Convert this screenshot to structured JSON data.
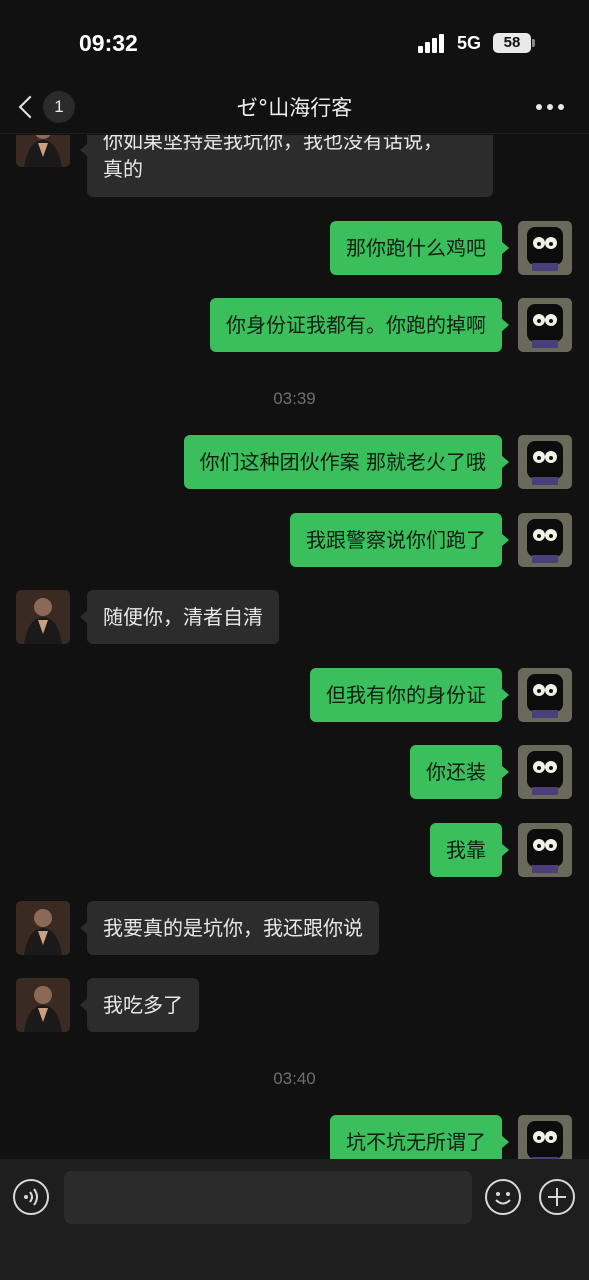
{
  "status_bar": {
    "time": "09:32",
    "network": "5G",
    "battery": "58",
    "signal_icon": "signal-bars-icon"
  },
  "nav": {
    "unread_count": "1",
    "title": "ゼ°山海行客",
    "back_icon": "chevron-left-icon",
    "more_icon": "more-dots-icon"
  },
  "messages": [
    {
      "side": "in",
      "text": "你如果坚持是我坑你，我也没有话说，\n真的"
    },
    {
      "side": "out",
      "text": "那你跑什么鸡吧"
    },
    {
      "side": "out",
      "text": "你身份证我都有。你跑的掉啊"
    },
    {
      "type": "time",
      "text": "03:39"
    },
    {
      "side": "out",
      "text": "你们这种团伙作案 那就老火了哦"
    },
    {
      "side": "out",
      "text": "我跟警察说你们跑了"
    },
    {
      "side": "in",
      "text": "随便你，清者自清"
    },
    {
      "side": "out",
      "text": "但我有你的身份证"
    },
    {
      "side": "out",
      "text": "你还装"
    },
    {
      "side": "out",
      "text": "我靠"
    },
    {
      "side": "in",
      "text": "我要真的是坑你，我还跟你说"
    },
    {
      "side": "in",
      "text": "我吃多了"
    },
    {
      "type": "time",
      "text": "03:40"
    },
    {
      "side": "out",
      "text": "坑不坑无所谓了"
    }
  ],
  "input_bar": {
    "placeholder": "",
    "voice_icon": "voice-icon",
    "emoji_icon": "emoji-icon",
    "plus_icon": "plus-icon"
  },
  "colors": {
    "background": "#111111",
    "outgoing_bubble": "#3bbf5c",
    "incoming_bubble": "#2c2c2c",
    "timestamp": "#6f6f6f"
  }
}
